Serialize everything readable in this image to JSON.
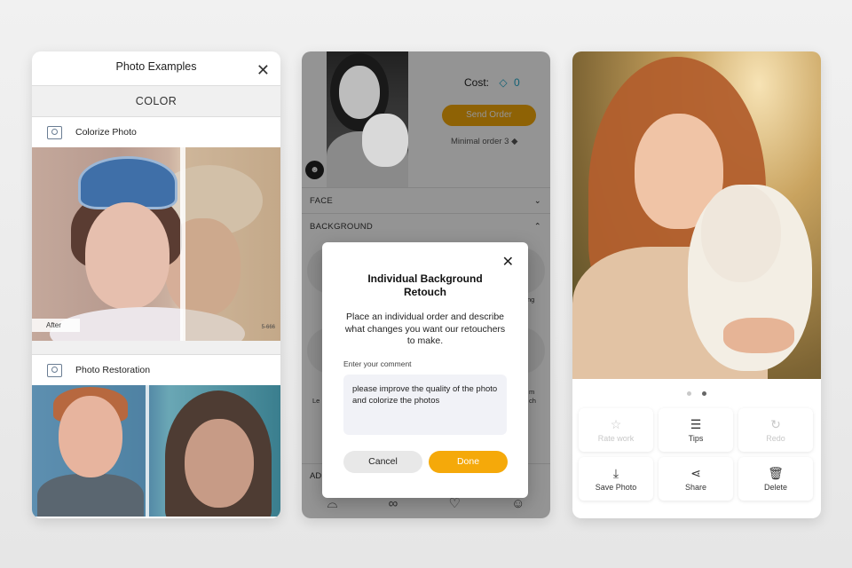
{
  "screen1": {
    "title": "Photo Examples",
    "section": "COLOR",
    "colorize_label": "Colorize Photo",
    "after_label": "After",
    "stamp": "5-666",
    "restoration_label": "Photo Restoration"
  },
  "screen2": {
    "cost_label": "Cost:",
    "cost_value": "0",
    "send_order": "Send Order",
    "minimal_order": "Minimal order  3",
    "face_section": "FACE",
    "background_section": "BACKGROUND",
    "bottom_section": "AD",
    "dialog": {
      "title": "Individual Background Retouch",
      "description": "Place an individual order and describe what changes you want our retouchers to make.",
      "comment_label": "Enter your comment",
      "comment_text": "please improve the quality of the photo and colorize the photos",
      "cancel": "Cancel",
      "done": "Done"
    },
    "side_labels": [
      "Le",
      "ng",
      "m",
      "ch"
    ]
  },
  "screen3": {
    "actions": [
      {
        "label": "Rate work",
        "icon": "star-icon",
        "enabled": false
      },
      {
        "label": "Tips",
        "icon": "stack-icon",
        "enabled": true
      },
      {
        "label": "Redo",
        "icon": "redo-icon",
        "enabled": false
      },
      {
        "label": "Save Photo",
        "icon": "download-icon",
        "enabled": true
      },
      {
        "label": "Share",
        "icon": "share-icon",
        "enabled": true
      },
      {
        "label": "Delete",
        "icon": "trash-icon",
        "enabled": true
      }
    ],
    "page_dots": {
      "count": 2,
      "active": 2
    }
  },
  "colors": {
    "accent": "#f5a90a",
    "diamond": "#1fa6c9"
  }
}
